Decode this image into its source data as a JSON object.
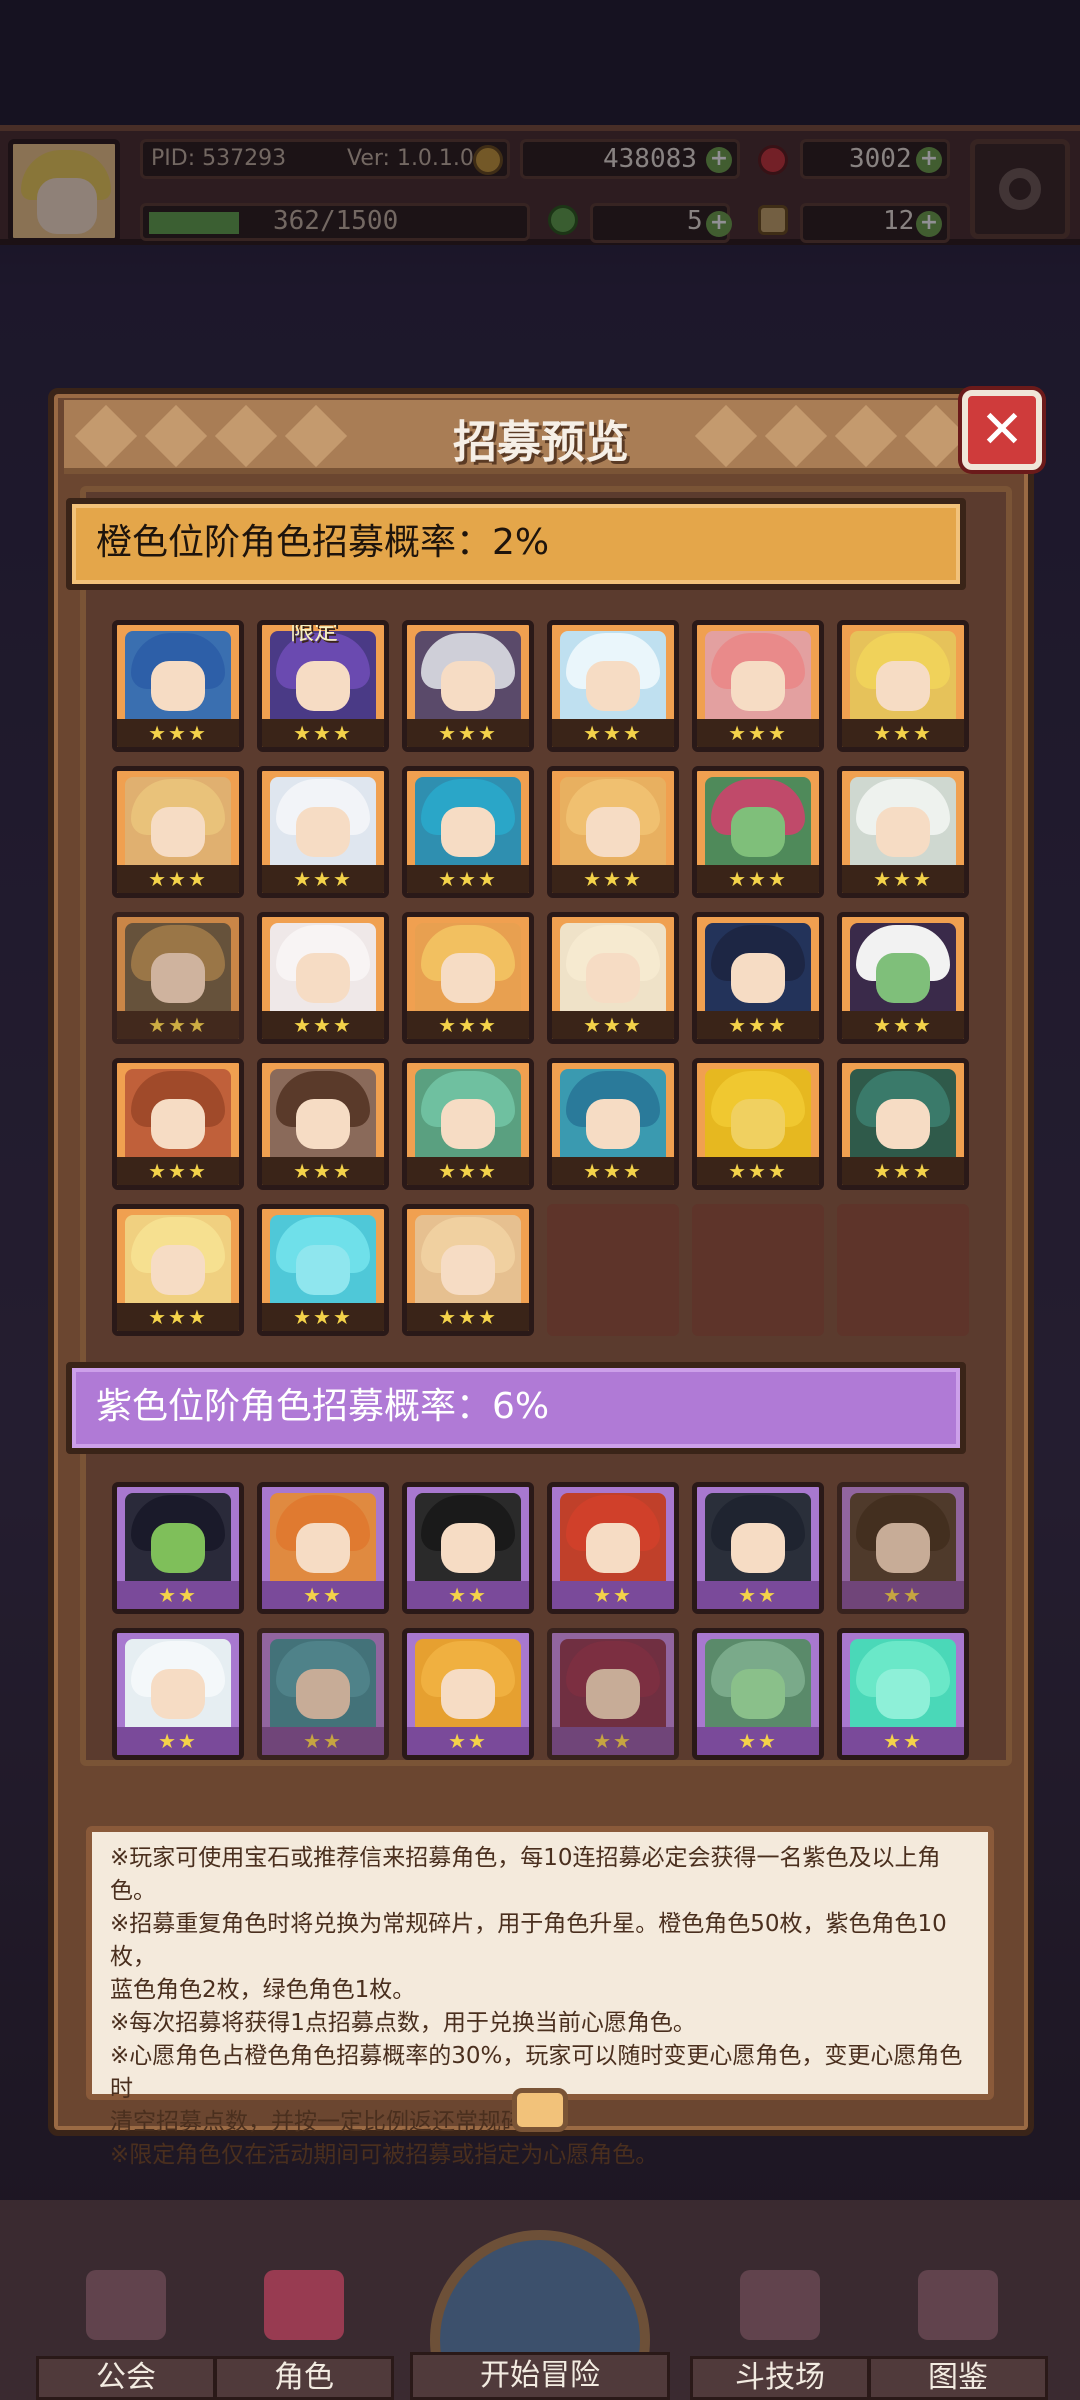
{
  "hud": {
    "pid": "PID: 537293",
    "version": "Ver: 1.0.1.0",
    "gold": "438083",
    "gems": "3002",
    "exp": "362/1500",
    "clover": "5",
    "hand": "12"
  },
  "modal": {
    "title": "招募预览",
    "orange_rate": "橙色位阶角色招募概率：2%",
    "purple_rate": "紫色位阶角色招募概率：6%",
    "orange_stars": "★★★",
    "purple_stars": "★★",
    "limited_tag": "限定",
    "notes": [
      "※玩家可使用宝石或推荐信来招募角色，每10连招募必定会获得一名紫色及以上角色。",
      "※招募重复角色时将兑换为常规碎片，用于角色升星。橙色角色50枚，紫色角色10枚，",
      "蓝色角色2枚，绿色角色1枚。",
      "※每次招募将获得1点招募点数，用于兑换当前心愿角色。",
      "※心愿角色占橙色角色招募概率的30%，玩家可以随时变更心愿角色，变更心愿角色时",
      "清空招募点数，并按一定比例返还常规碎片。",
      "※限定角色仅在活动期间可被招募或指定为心愿角色。"
    ]
  },
  "nav": {
    "guild": "公会",
    "character": "角色",
    "adventure": "开始冒险",
    "arena": "斗技场",
    "codex": "图鉴"
  },
  "colors": {
    "orange_frame": "#f0a050",
    "purple_frame": "#a878cf",
    "close_red": "#cf3b3b"
  }
}
